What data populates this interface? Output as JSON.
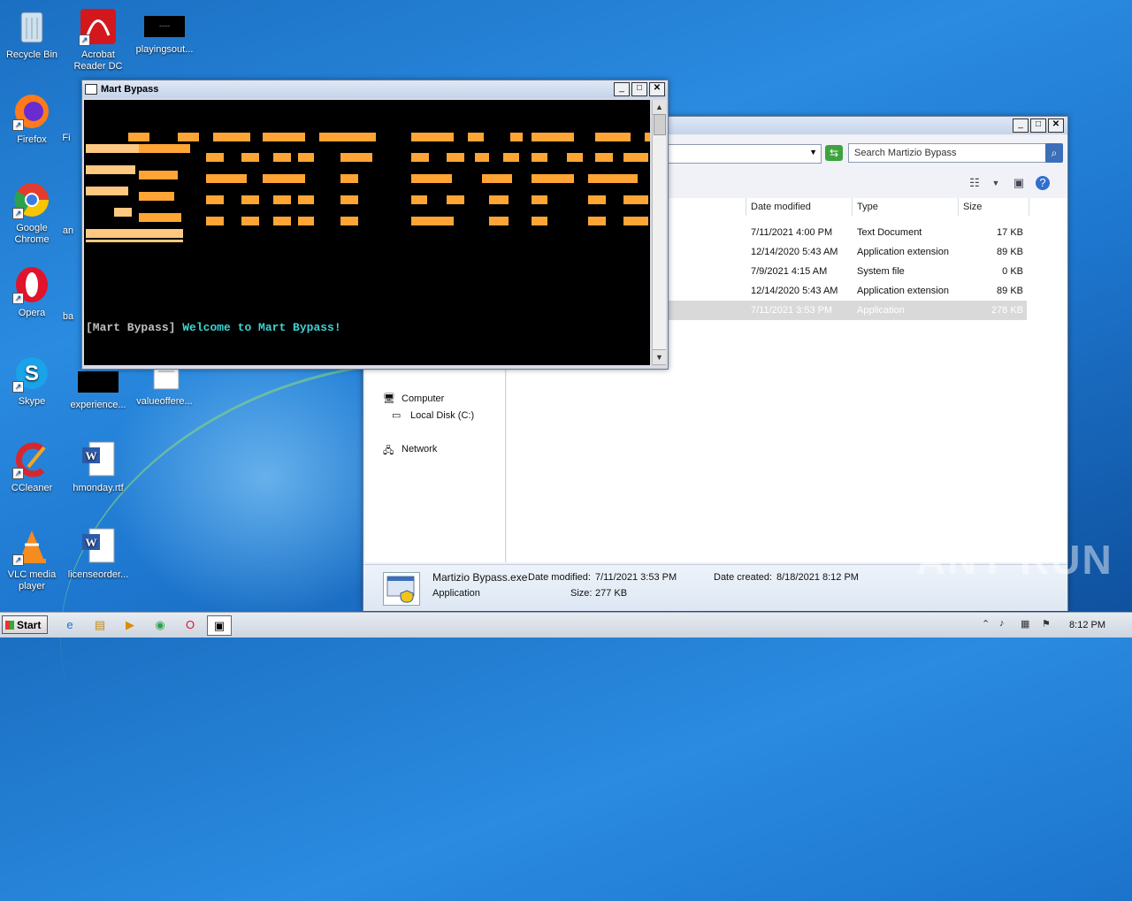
{
  "desktop": {
    "icons": [
      {
        "label": "Recycle Bin"
      },
      {
        "label": "Acrobat Reader DC"
      },
      {
        "label": "playingsout..."
      },
      {
        "label": "Firefox"
      },
      {
        "label": "Fi"
      },
      {
        "label": "Google Chrome"
      },
      {
        "label": "an"
      },
      {
        "label": "Opera"
      },
      {
        "label": "ba"
      },
      {
        "label": "Skype"
      },
      {
        "label": "experience..."
      },
      {
        "label": "valueoffere..."
      },
      {
        "label": "CCleaner"
      },
      {
        "label": "hmonday.rtf"
      },
      {
        "label": "VLC media player"
      },
      {
        "label": "licenseorder..."
      }
    ]
  },
  "console": {
    "title": "Mart Bypass",
    "prompt_tag": "[Mart Bypass]",
    "welcome_text": "Welcome to Mart Bypass!",
    "colors": {
      "tag": "#c0c0c0",
      "welcome": "#3fd2d2",
      "art": "#ffa535"
    }
  },
  "explorer": {
    "search_placeholder": "Search Martizio Bypass",
    "columns": [
      "Date modified",
      "Type",
      "Size"
    ],
    "files": [
      {
        "date": "7/11/2021 4:00 PM",
        "type": "Text Document",
        "size": "17 KB"
      },
      {
        "date": "12/14/2020 5:43 AM",
        "type": "Application extension",
        "size": "89 KB"
      },
      {
        "date": "7/9/2021 4:15 AM",
        "type": "System file",
        "size": "0 KB"
      },
      {
        "date": "12/14/2020 5:43 AM",
        "type": "Application extension",
        "size": "89 KB"
      },
      {
        "date": "7/11/2021 3:53 PM",
        "type": "Application",
        "size": "278 KB",
        "selected": true
      }
    ],
    "nav": {
      "computer": "Computer",
      "local_disk": "Local Disk (C:)",
      "network": "Network"
    },
    "details": {
      "filename": "Martizio Bypass.exe",
      "kind": "Application",
      "date_modified_label": "Date modified:",
      "date_modified": "7/11/2021 3:53 PM",
      "size_label": "Size:",
      "size": "277 KB",
      "date_created_label": "Date created:",
      "date_created": "8/18/2021 8:12 PM"
    }
  },
  "taskbar": {
    "start_label": "Start",
    "clock": "8:12 PM"
  },
  "watermark": "ANY RUN"
}
